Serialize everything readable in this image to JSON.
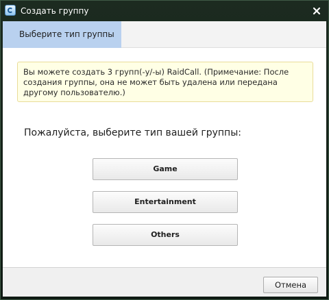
{
  "window": {
    "title": "Создать группу",
    "icons": {
      "app": "raidcall-app-icon",
      "close": "close-icon"
    }
  },
  "tabs": [
    {
      "label": "Выберите тип группы",
      "active": true
    }
  ],
  "notice": {
    "text": "Вы можете создать 3 групп(-у/-ы) RaidCall. (Примечание: После создания группы, она не может быть удалена или передана другому пользователю.)"
  },
  "prompt": "Пожалуйста, выберите тип вашей группы:",
  "group_types": [
    {
      "label": "Game"
    },
    {
      "label": "Entertainment"
    },
    {
      "label": "Others"
    }
  ],
  "footer": {
    "cancel_label": "Отмена"
  },
  "colors": {
    "active_tab": "#b9d1ef",
    "notice_background": "#ffffe5",
    "notice_border": "#e9dc98"
  }
}
